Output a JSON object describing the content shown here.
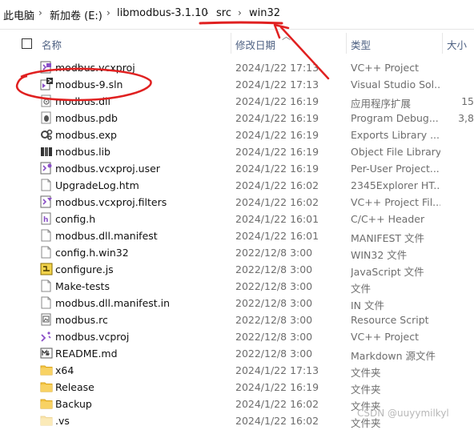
{
  "breadcrumb": {
    "items": [
      "此电脑",
      "新加卷 (E:)",
      "libmodbus-3.1.10",
      "src",
      "win32"
    ],
    "separator": "›"
  },
  "columns": {
    "name": "名称",
    "date": "修改日期",
    "type": "类型",
    "size": "大小"
  },
  "files": [
    {
      "name": "modbus.vcxproj",
      "date": "2024/1/22 17:13",
      "type": "VC++ Project",
      "size": "",
      "icon": "vcxproj-icon"
    },
    {
      "name": "modbus-9.sln",
      "date": "2024/1/22 17:13",
      "type": "Visual Studio Sol...",
      "size": "",
      "icon": "visual-studio-solution-icon"
    },
    {
      "name": "modbus.dll",
      "date": "2024/1/22 16:19",
      "type": "应用程序扩展",
      "size": "15",
      "icon": "dll-icon"
    },
    {
      "name": "modbus.pdb",
      "date": "2024/1/22 16:19",
      "type": "Program Debug...",
      "size": "3,8",
      "icon": "pdb-icon"
    },
    {
      "name": "modbus.exp",
      "date": "2024/1/22 16:19",
      "type": "Exports Library ...",
      "size": "",
      "icon": "exp-icon"
    },
    {
      "name": "modbus.lib",
      "date": "2024/1/22 16:19",
      "type": "Object File Library",
      "size": "",
      "icon": "lib-icon"
    },
    {
      "name": "modbus.vcxproj.user",
      "date": "2024/1/22 16:19",
      "type": "Per-User Project...",
      "size": "",
      "icon": "vcxproj-user-icon"
    },
    {
      "name": "UpgradeLog.htm",
      "date": "2024/1/22 16:02",
      "type": "2345Explorer HT...",
      "size": "",
      "icon": "document-icon"
    },
    {
      "name": "modbus.vcxproj.filters",
      "date": "2024/1/22 16:02",
      "type": "VC++ Project Fil...",
      "size": "",
      "icon": "vcxproj-filters-icon"
    },
    {
      "name": "config.h",
      "date": "2024/1/22 16:01",
      "type": "C/C++ Header",
      "size": "",
      "icon": "header-file-icon"
    },
    {
      "name": "modbus.dll.manifest",
      "date": "2024/1/22 16:01",
      "type": "MANIFEST 文件",
      "size": "",
      "icon": "document-icon"
    },
    {
      "name": "config.h.win32",
      "date": "2022/12/8 3:00",
      "type": "WIN32 文件",
      "size": "",
      "icon": "document-icon"
    },
    {
      "name": "configure.js",
      "date": "2022/12/8 3:00",
      "type": "JavaScript 文件",
      "size": "",
      "icon": "javascript-file-icon"
    },
    {
      "name": "Make-tests",
      "date": "2022/12/8 3:00",
      "type": "文件",
      "size": "",
      "icon": "document-icon"
    },
    {
      "name": "modbus.dll.manifest.in",
      "date": "2022/12/8 3:00",
      "type": "IN 文件",
      "size": "",
      "icon": "document-icon"
    },
    {
      "name": "modbus.rc",
      "date": "2022/12/8 3:00",
      "type": "Resource Script",
      "size": "",
      "icon": "resource-script-icon"
    },
    {
      "name": "modbus.vcproj",
      "date": "2022/12/8 3:00",
      "type": "VC++ Project",
      "size": "",
      "icon": "vcproj-icon"
    },
    {
      "name": "README.md",
      "date": "2022/12/8 3:00",
      "type": "Markdown 源文件",
      "size": "",
      "icon": "markdown-file-icon"
    },
    {
      "name": "x64",
      "date": "2024/1/22 17:13",
      "type": "文件夹",
      "size": "",
      "icon": "folder-icon"
    },
    {
      "name": "Release",
      "date": "2024/1/22 16:19",
      "type": "文件夹",
      "size": "",
      "icon": "folder-icon"
    },
    {
      "name": "Backup",
      "date": "2024/1/22 16:02",
      "type": "文件夹",
      "size": "",
      "icon": "folder-icon"
    },
    {
      "name": ".vs",
      "date": "2024/1/22 16:02",
      "type": "文件夹",
      "size": "",
      "icon": "hidden-folder-icon"
    }
  ],
  "watermark": "CSDN @uuyymilkyl",
  "colors": {
    "annotation": "#e02020",
    "header_text": "#4d6082",
    "folder": "#f4c544",
    "vs_purple": "#8a4fc7"
  }
}
